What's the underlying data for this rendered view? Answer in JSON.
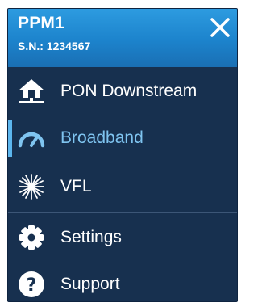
{
  "header": {
    "device_name": "PPM1",
    "serial": "S.N.: 1234567"
  },
  "menu": {
    "items": [
      {
        "label": "PON Downstream",
        "icon": "home-network-icon",
        "active": false
      },
      {
        "label": "Broadband",
        "icon": "gauge-icon",
        "active": true
      },
      {
        "label": "VFL",
        "icon": "laser-burst-icon",
        "active": false
      },
      {
        "label": "Settings",
        "icon": "gear-icon",
        "active": false
      },
      {
        "label": "Support",
        "icon": "help-icon",
        "active": false
      }
    ]
  },
  "colors": {
    "header_top": "#2d9be0",
    "panel_bg": "#17304f",
    "active_text": "#7fc4f0",
    "active_indicator": "#5cb6ee"
  }
}
